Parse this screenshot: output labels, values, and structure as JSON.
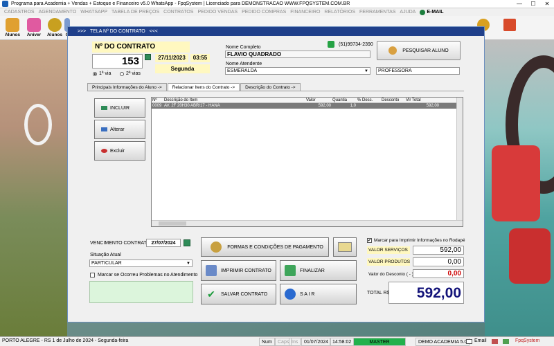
{
  "window": {
    "title": "Programa para Academia + Vendas + Estoque e Financeiro v5.0 WhatsApp - FpqSystem | Licenciado para  DEMONSTRACAO WWW.FPQSYSTEM.COM.BR",
    "minimize": "—",
    "maximize": "☐",
    "close": "✕"
  },
  "menu": {
    "items": [
      "CADASTROS",
      "AGENDAMENTO",
      "WHATSAPP",
      "TABELA DE PREÇOS",
      "CONTRATOS",
      "PEDIDO VENDAS",
      "PEDIDO COMPRAS",
      "FINANCEIRO",
      "RELATÓRIOS",
      "FERRAMENTAS",
      "AJUDA"
    ],
    "email": "E-MAIL"
  },
  "toolbar": {
    "alunos": "Alunos",
    "aniver": "Aniver",
    "alunos2": "Alunos",
    "c": "C"
  },
  "dialog": {
    "header": ">>>   TELA Nº DO CONTRATO   <<<",
    "contract_label": "Nº DO CONTRATO",
    "contract_number": "153",
    "date": "27/11/2023",
    "time": "03:55",
    "weekday": "Segunda",
    "via1": "1ª via",
    "via2": "2ª vias",
    "nome_label": "Nome Completo",
    "nome": "FLAVIO QUADRADO",
    "phone": "(51)99734-2390",
    "atendente_label": "Nome Atendente",
    "atendente": "ESMERALDA",
    "cargo": "PROFESSORA",
    "search_btn": "PESQUISAR ALUNO",
    "tabs": [
      "Principais Informações do Aluno ->",
      "Relacionar Itens do Contrato ->",
      "Descrição do Contrato ->"
    ],
    "incluir": "INCLUIR",
    "alterar": "Alterar",
    "excluir": "Excluir",
    "grid": {
      "headers": [
        "Nº",
        "Descrição do Item",
        "Valor",
        "Quantia",
        "% Desc.",
        "Desconto",
        "Vlr Total"
      ],
      "rows": [
        [
          "0009",
          "AV. 2F 20H30 ABR/17 - HANA",
          "592,00",
          "1,0",
          "",
          "",
          "592,00"
        ]
      ]
    },
    "vencimento_label": "VENCIMENTO CONTRATO:",
    "vencimento": "27/07/2024",
    "situacao_label": "Situação Atual",
    "situacao": "PARTICULAR",
    "problemas": "Marcar se Ocorreu Problemas no Atendimento",
    "formas_btn": "FORMAS E CONDIÇÕES DE PAGAMENTO",
    "imprimir_btn": "IMPRIMIR CONTRATO",
    "finalizar_btn": "FINALIZAR",
    "salvar_btn": "SALVAR CONTRATO",
    "sair_btn": "S A I R",
    "marcar_rodape": "Marcar para Imprimir Informações no Rodapé",
    "valor_servicos_label": "VALOR SERVIÇOS",
    "valor_servicos": "592,00",
    "valor_produtos_label": "VALOR PRODUTOS",
    "valor_produtos": "0,00",
    "valor_desconto_label": "Valor do Desconto ( - )",
    "valor_desconto": "0,00",
    "total_label": "TOTAL R$",
    "total": "592,00"
  },
  "status": {
    "location": "PORTO ALEGRE - RS   1 de Julho de 2024 - Segunda-feira",
    "num": "Num",
    "caps": "Caps",
    "ins": "Ins",
    "date": "01/07/2024",
    "time": "14:58:02",
    "master": "MASTER",
    "version": "DEMO ACADEMIA 5.0",
    "email": "Email",
    "brand": "FpqSystem"
  },
  "colors": {
    "header_blue": "#1f3f8a",
    "total_blue": "#14147a",
    "discount_red": "#cc0000",
    "master_green": "#22b14c"
  }
}
